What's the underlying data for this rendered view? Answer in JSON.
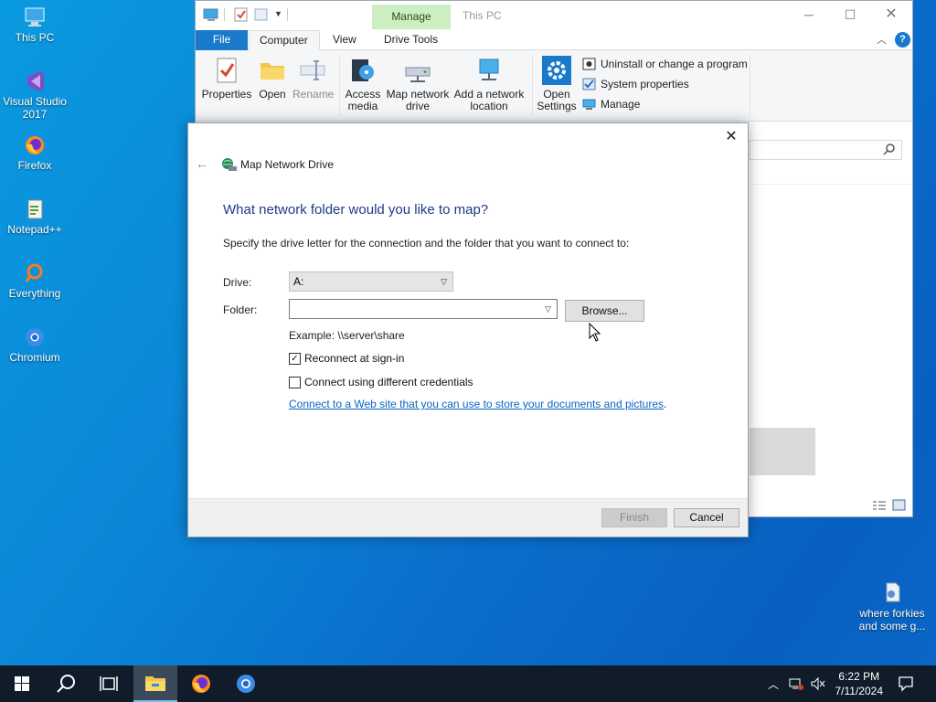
{
  "desktop": {
    "icons": [
      {
        "label": "This PC"
      },
      {
        "label": "Visual Studio 2017"
      },
      {
        "label": "Firefox"
      },
      {
        "label": "Notepad++"
      },
      {
        "label": "Everything"
      },
      {
        "label": "Chromium"
      },
      {
        "label": "where forkies and some g..."
      }
    ]
  },
  "explorer": {
    "title": "This PC",
    "context_tab": "Manage",
    "tabs": {
      "file": "File",
      "computer": "Computer",
      "view": "View",
      "drive_tools": "Drive Tools"
    },
    "ribbon": {
      "properties": "Properties",
      "open": "Open",
      "rename": "Rename",
      "access_media": "Access media",
      "map_network_drive": "Map network drive",
      "add_network_location": "Add a network location",
      "open_settings": "Open Settings",
      "uninstall": "Uninstall or change a program",
      "system_properties": "System properties",
      "manage": "Manage"
    }
  },
  "dialog": {
    "title": "Map Network Drive",
    "heading": "What network folder would you like to map?",
    "description": "Specify the drive letter for the connection and the folder that you want to connect to:",
    "drive_label": "Drive:",
    "drive_value": "A:",
    "folder_label": "Folder:",
    "folder_value": "",
    "browse": "Browse...",
    "example": "Example: \\\\server\\share",
    "reconnect": {
      "label": "Reconnect at sign-in",
      "checked": true
    },
    "credentials": {
      "label": "Connect using different credentials",
      "checked": false
    },
    "link": "Connect to a Web site that you can use to store your documents and pictures",
    "finish": "Finish",
    "cancel": "Cancel"
  },
  "taskbar": {
    "time": "6:22 PM",
    "date": "7/11/2024"
  },
  "colors": {
    "accent": "#1979ca",
    "heading": "#1e3b8a",
    "link": "#0b63c5",
    "manage_tab": "#cdeec0"
  }
}
